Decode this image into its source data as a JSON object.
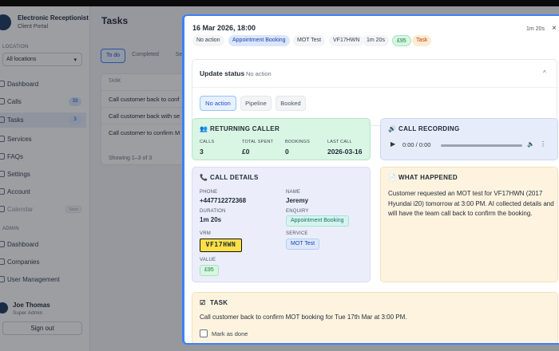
{
  "app": {
    "brand_title": "Electronic Receptionist",
    "brand_subtitle": "Client Portal",
    "location_label": "LOCATION",
    "location_value": "All locations",
    "nav": [
      {
        "label": "Dashboard",
        "badge": ""
      },
      {
        "label": "Calls",
        "badge": "33"
      },
      {
        "label": "Tasks",
        "badge": "3"
      },
      {
        "label": "Services",
        "badge": ""
      },
      {
        "label": "FAQs",
        "badge": ""
      },
      {
        "label": "Settings",
        "badge": ""
      },
      {
        "label": "Account",
        "badge": ""
      },
      {
        "label": "Calendar",
        "badge": "Soon"
      }
    ],
    "admin_label": "ADMIN",
    "admin_nav": [
      "Dashboard",
      "Companies",
      "User Management"
    ],
    "user_name": "Joe Thomas",
    "user_role": "Super Admin",
    "signout_label": "Sign out",
    "page_title": "Tasks",
    "tabs": [
      "To do",
      "Completed",
      "Se"
    ],
    "table_header": "TASK",
    "rows": [
      "Call customer back to conf",
      "Call customer back with se",
      "Call customer to confirm M"
    ],
    "showing": "Showing 1–3 of 3"
  },
  "modal": {
    "datetime": "16 Mar 2026, 18:00",
    "duration": "1m 20s",
    "close": "×",
    "chips": {
      "status": "No action",
      "enquiry": "Appointment Booking",
      "service": "MOT Test",
      "vrm": "VF17HWN",
      "duration": "1m 20s",
      "value": "£95",
      "type": "Task"
    },
    "update_status": {
      "title": "Update status",
      "current": "No action",
      "options": [
        "No action",
        "Pipeline",
        "Booked"
      ]
    },
    "returning_caller": {
      "heading": "RETURNING CALLER",
      "labels": [
        "CALLS",
        "TOTAL SPENT",
        "BOOKINGS",
        "LAST CALL"
      ],
      "values": [
        "3",
        "£0",
        "0",
        "2026-03-16"
      ]
    },
    "call_recording": {
      "heading": "CALL RECORDING",
      "time": "0:00 / 0:00"
    },
    "call_details": {
      "heading": "CALL DETAILS",
      "phone_label": "PHONE",
      "phone": "+447712272368",
      "name_label": "NAME",
      "name": "Jeremy",
      "duration_label": "DURATION",
      "duration": "1m 20s",
      "enquiry_label": "ENQUIRY",
      "enquiry": "Appointment Booking",
      "vrm_label": "VRM",
      "vrm": "VF17HWN",
      "service_label": "SERVICE",
      "service": "MOT Test",
      "value_label": "VALUE",
      "value": "£95"
    },
    "what_happened": {
      "heading": "WHAT HAPPENED",
      "text": "Customer requested an MOT test for VF17HWN (2017 Hyundai i20) tomorrow at 3:00 PM. AI collected details and will have the team call back to confirm the booking."
    },
    "task": {
      "heading": "TASK",
      "text": "Call customer back to confirm MOT booking for Tue 17th Mar at 3:00 PM.",
      "mark_done": "Mark as done"
    }
  }
}
